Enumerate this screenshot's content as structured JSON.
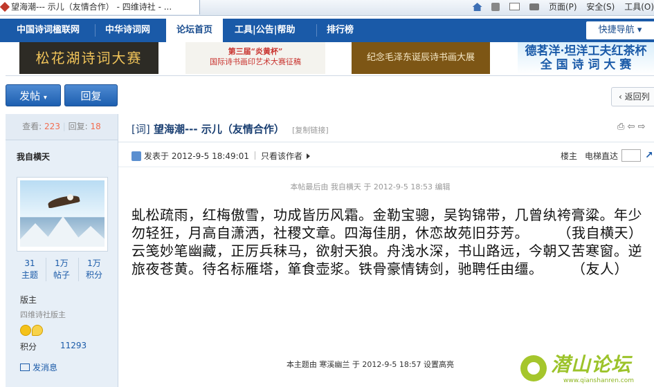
{
  "browser": {
    "tab_title": "望海潮--- 示儿（友情合作） - 四维诗社 - ...",
    "commands": [
      "页面(P)",
      "安全(S)",
      "工具(O)"
    ]
  },
  "nav": {
    "items": [
      "中国诗词楹联网",
      "中华诗词网",
      "论坛首页",
      "工具|公告|帮助",
      "排行榜"
    ],
    "quick_nav": "快捷导航"
  },
  "banners": {
    "b1": "松花湖诗词大赛",
    "b2_line1": "第三届“炎黄杯”",
    "b2_line2": "国际诗书画印艺术大赛征稿",
    "b3": "纪念毛泽东诞辰诗书画大展",
    "b4_line1": "德茗洋·坦洋工夫红茶杯",
    "b4_line2": "全 国 诗 词 大 赛"
  },
  "actions": {
    "post": "发帖",
    "reply": "回复",
    "back": "返回列"
  },
  "thread": {
    "views_label": "查看:",
    "views": "223",
    "replies_label": "回复:",
    "replies": "18",
    "tag": "[词]",
    "title": "望海潮--- 示儿（友情合作）",
    "copy_link": "[复制链接]"
  },
  "author": {
    "name": "我自横天",
    "topics": "31",
    "topics_label": "主题",
    "posts": "1万",
    "posts_label": "帖子",
    "credits": "1万",
    "credits_label": "积分",
    "role": "版主",
    "role_sub": "四维诗社版主",
    "points_label": "积分",
    "points": "11293",
    "message": "发消息"
  },
  "post": {
    "posted_at": "发表于 2012-9-5 18:49:01",
    "only_author": "只看该作者",
    "floor": "楼主",
    "jump": "电梯直达",
    "edit_note": "本帖最后由 我自横天 于 2012-9-5 18:53 编辑",
    "para1": "虬松疏雨，红梅傲雪，功成皆历风霜。金勒宝骢，吴钩锦带，几曾纨袴膏粱。年少勿轻狂，月高自潇洒，社稷文章。四海佳朋，休恋故苑旧芬芳。　　　（我自横天）",
    "para2": "云笺妙笔幽藏，正厉兵秣马，欲射天狼。舟浅水深，书山路远，今朝又苦寒窗。逆旅夜苍黄。待名标雁塔，箪食壶浆。铁骨豪情铸剑，驰聘任由缰。　　　（友人）",
    "highlight_note": "本主题由 寒溪幽兰 于 2012-9-5 18:57 设置高亮"
  },
  "watermark": {
    "text": "潜山论坛",
    "url": "www.qianshanren.com"
  }
}
